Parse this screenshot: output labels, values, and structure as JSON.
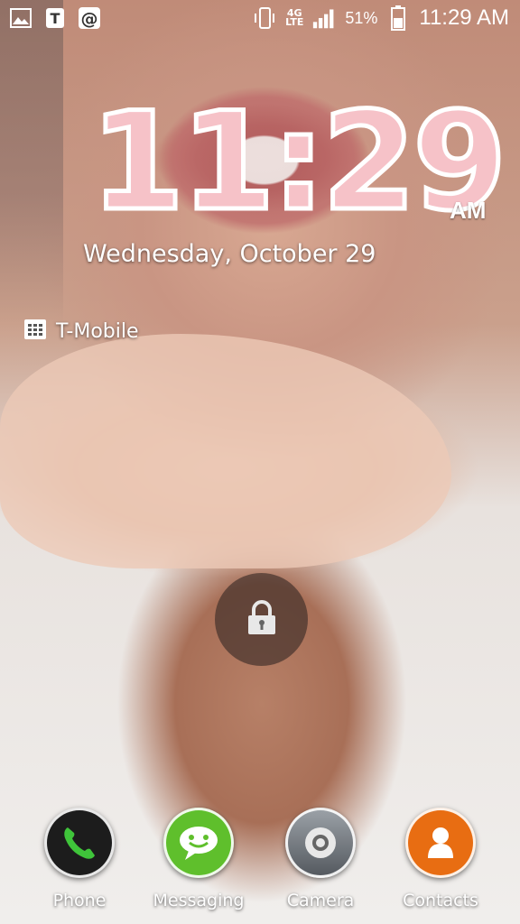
{
  "statusbar": {
    "left_icons": [
      "gallery-icon",
      "tmobile-icon",
      "email-icon"
    ],
    "network": "4G",
    "network_sub": "LTE",
    "battery": "51%",
    "time": "11:29 AM"
  },
  "lockscreen": {
    "clock_time": "11:29",
    "clock_ampm": "AM",
    "date": "Wednesday, October 29",
    "carrier": "T-Mobile"
  },
  "dock": {
    "apps": [
      {
        "label": "Phone",
        "icon": "phone-icon",
        "color": "#1a1a1a"
      },
      {
        "label": "Messaging",
        "icon": "messaging-icon",
        "color": "#5fbf2c"
      },
      {
        "label": "Camera",
        "icon": "camera-icon",
        "color": "#6f7378"
      },
      {
        "label": "Contacts",
        "icon": "contacts-icon",
        "color": "#e86d12"
      }
    ]
  }
}
